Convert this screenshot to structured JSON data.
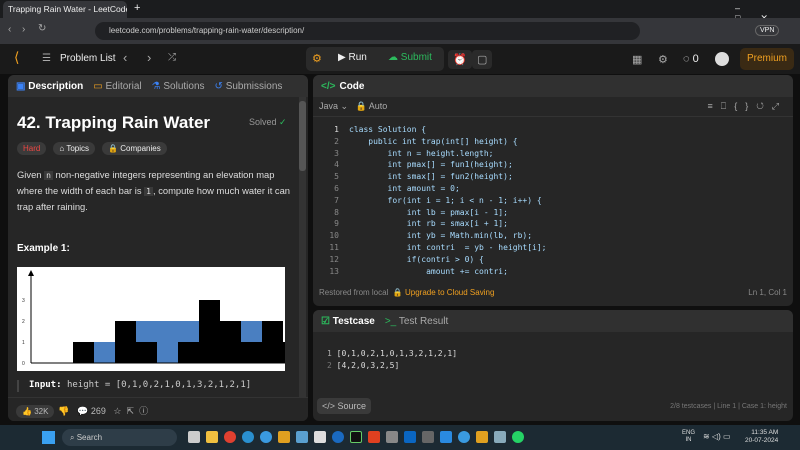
{
  "browser": {
    "tab_title": "Trapping Rain Water - LeetCode",
    "url": "leetcode.com/problems/trapping-rain-water/description/",
    "vpn": "VPN"
  },
  "header": {
    "problem_list": "Problem List",
    "run": "Run",
    "submit": "Submit",
    "streak": "0",
    "premium": "Premium"
  },
  "left": {
    "tabs": [
      {
        "label": "Description"
      },
      {
        "label": "Editorial"
      },
      {
        "label": "Solutions"
      },
      {
        "label": "Submissions"
      }
    ],
    "title": "42. Trapping Rain Water",
    "status": "Solved",
    "tags": {
      "difficulty": "Hard",
      "topics": "Topics",
      "companies": "Companies"
    },
    "desc": {
      "p1": "Given ",
      "n": "n",
      "p2": " non-negative integers representing an elevation map where the width of each bar is ",
      "one": "1",
      "p3": ", compute how much water it can trap after raining."
    },
    "example_title": "Example 1:",
    "figure": {
      "heights": [
        0,
        1,
        0,
        2,
        1,
        0,
        1,
        3,
        2,
        1,
        2,
        1
      ],
      "water": [
        0,
        0,
        1,
        0,
        1,
        2,
        1,
        0,
        0,
        1,
        0,
        0
      ],
      "y_ticks": [
        "0",
        "1",
        "2",
        "3"
      ],
      "bar_color": "#000000",
      "water_color": "#4a7fc1"
    },
    "input_label": "Input:",
    "input_value": "height = [0,1,0,2,1,0,1,3,2,1,2,1]",
    "footer": {
      "likes": "32K",
      "comments": "269"
    }
  },
  "code": {
    "title": "Code",
    "language": "Java",
    "auto": "Auto",
    "lines": [
      "class Solution {",
      "    public int trap(int[] height) {",
      "        int n = height.length;",
      "        int pmax[] = fun1(height);",
      "        int smax[] = fun2(height);",
      "        int amount = 0;",
      "        for(int i = 1; i < n - 1; i++) {",
      "            int lb = pmax[i - 1];",
      "            int rb = smax[i + 1];",
      "            int yb = Math.min(lb, rb);",
      "            int contri  = yb - height[i];",
      "            if(contri > 0) {",
      "                amount += contri;"
    ],
    "restored": "Restored from local",
    "upgrade": "Upgrade to Cloud Saving",
    "cursor": "Ln 1, Col 1"
  },
  "testcase": {
    "tab1": "Testcase",
    "tab2": "Test Result",
    "lines": [
      "[0,1,0,2,1,0,1,3,2,1,2,1]",
      "[4,2,0,3,2,5]"
    ],
    "source": "Source",
    "status": "2/8 testcases  |  Line 1  |  Case 1: height"
  },
  "taskbar": {
    "search": "Search",
    "lang": "ENG",
    "region": "IN",
    "time": "11:35 AM",
    "date": "20-07-2024"
  }
}
